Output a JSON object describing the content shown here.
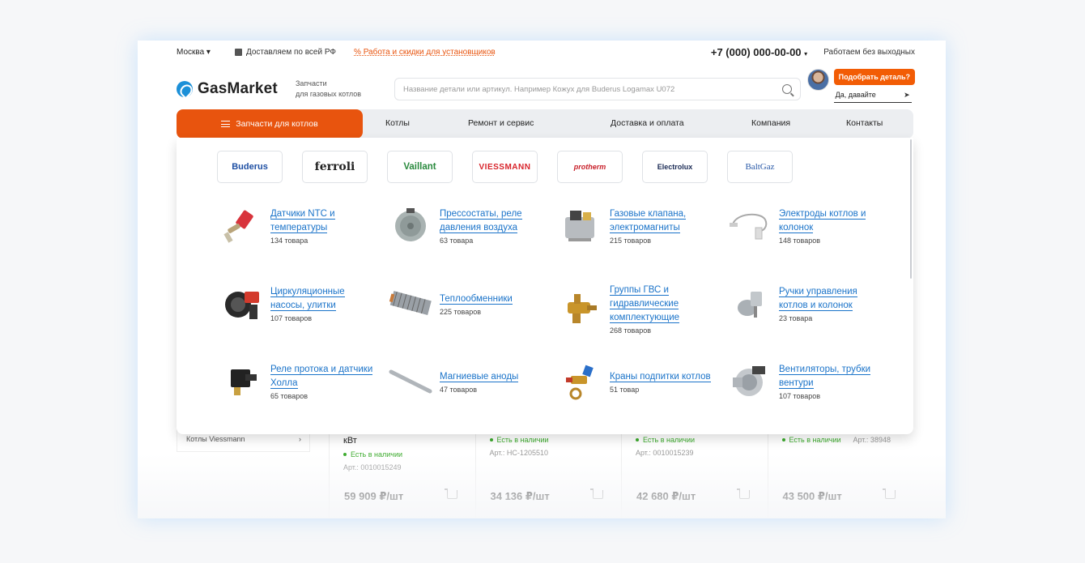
{
  "topbar": {
    "city": "Москва ▾",
    "shipping": "Доставляем по всей РФ",
    "promo": "% Работа и скидки для установщиков",
    "phone": "+7 (000) 000-00-00",
    "phone_caret": "▾",
    "hours": "Работаем без выходных"
  },
  "header": {
    "logo": "GasMarket",
    "tagline_1": "Запчасти",
    "tagline_2": "для газовых котлов",
    "search_placeholder": "Название детали или артикул. Например Кожух для Buderus Logamax U072",
    "helper_button": "Подобрать деталь?",
    "helper_reply": "Да, давайте",
    "send_glyph": "➤"
  },
  "nav": {
    "main": "Запчасти для котлов",
    "items": [
      "Котлы",
      "Ремонт и сервис",
      "Доставка и оплата",
      "Компания",
      "Контакты"
    ]
  },
  "brands": [
    "Buderus",
    "ferroli",
    "Vaillant",
    "VIESSMANN",
    "protherm",
    "Electrolux",
    "BaltGaz"
  ],
  "categories": [
    {
      "title": "Датчики NTC и температуры",
      "count": "134 товара"
    },
    {
      "title": "Прессостаты, реле давления воздуха",
      "count": "63 товара"
    },
    {
      "title": "Газовые клапана, электромагниты",
      "count": "215 товаров"
    },
    {
      "title": "Электроды котлов и колонок",
      "count": "148 товаров"
    },
    {
      "title": "Циркуляционные насосы, улитки",
      "count": "107 товаров"
    },
    {
      "title": "Теплообменники",
      "count": "225 товаров"
    },
    {
      "title": "Группы ГВС и гидравлические комплектующие",
      "count": "268 товаров"
    },
    {
      "title": "Ручки управления котлов и колонок",
      "count": "23 товара"
    },
    {
      "title": "Реле протока и датчики Холла",
      "count": "65 товаров"
    },
    {
      "title": "Магниевые аноды",
      "count": "47 товаров"
    },
    {
      "title": "Краны подпитки котлов",
      "count": "51 товар"
    },
    {
      "title": "Вентиляторы, трубки вентури",
      "count": "107 товаров"
    }
  ],
  "sidebar": {
    "last_item": "Котлы Viessmann",
    "arrow": "›"
  },
  "products": [
    {
      "name": "кВт",
      "stock": "Есть в наличии",
      "sku": "Арт.: 0010015249",
      "price": "59 909 ₽/шт"
    },
    {
      "name": "",
      "stock": "Есть в наличии",
      "sku": "Арт.: НС-1205510",
      "price": "34 136 ₽/шт"
    },
    {
      "name": "",
      "stock": "Есть в наличии",
      "sku": "Арт.: 0010015239",
      "price": "42 680 ₽/шт"
    },
    {
      "name": "",
      "stock": "Есть в наличии",
      "sku": "Арт.: 38948",
      "price": "43 500 ₽/шт"
    }
  ],
  "colors": {
    "accent": "#e8540e",
    "link": "#1a73c9",
    "in_stock": "#3dab2e"
  }
}
